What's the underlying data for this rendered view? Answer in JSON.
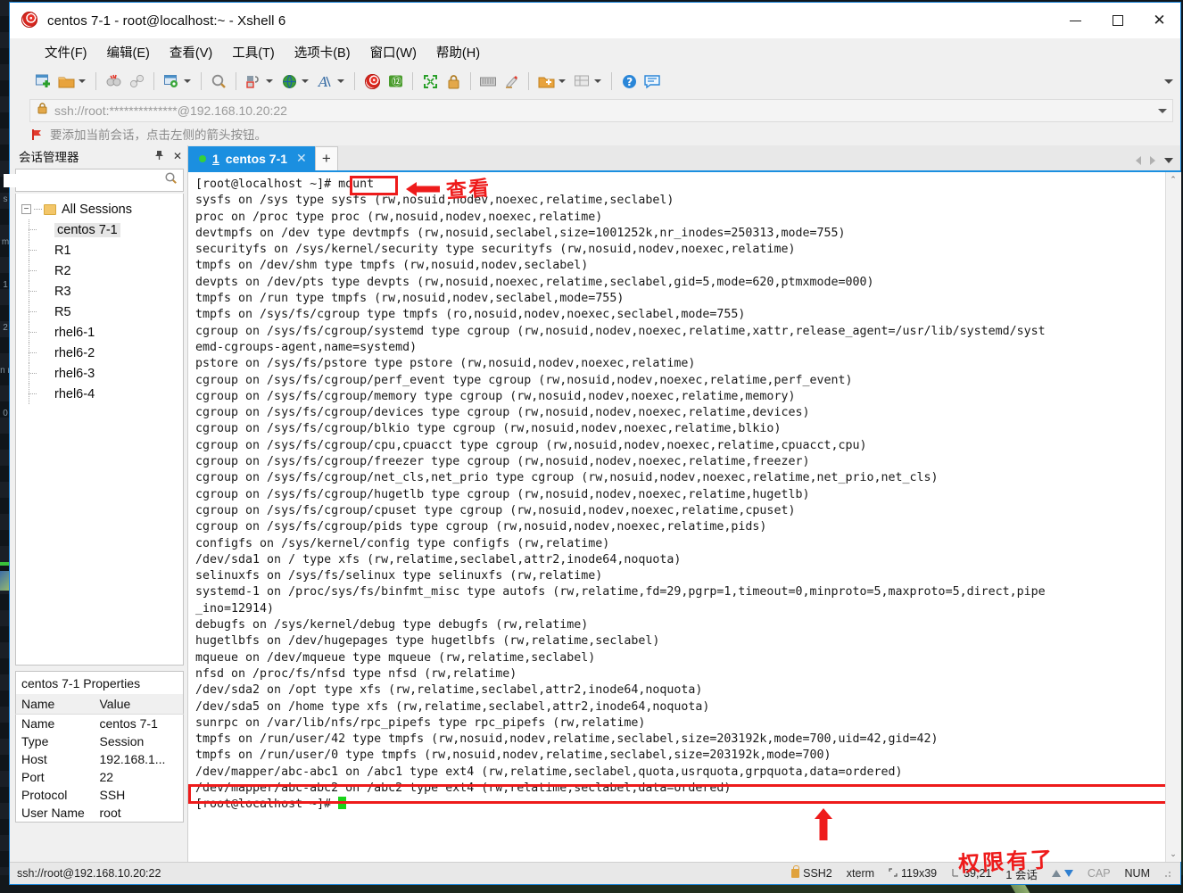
{
  "window": {
    "title": "centos 7-1 - root@localhost:~ - Xshell 6",
    "app_icon": "xshell-logo-icon",
    "controls": {
      "minimize": "–",
      "maximize": "□",
      "close": "✕"
    }
  },
  "menu": {
    "items": [
      {
        "label": "文件(F)",
        "name": "menu-file"
      },
      {
        "label": "编辑(E)",
        "name": "menu-edit"
      },
      {
        "label": "查看(V)",
        "name": "menu-view"
      },
      {
        "label": "工具(T)",
        "name": "menu-tools"
      },
      {
        "label": "选项卡(B)",
        "name": "menu-tabs"
      },
      {
        "label": "窗口(W)",
        "name": "menu-window"
      },
      {
        "label": "帮助(H)",
        "name": "menu-help"
      }
    ]
  },
  "toolbar": {
    "buttons": [
      {
        "name": "new-session-icon",
        "glyph": "▣",
        "dropdown": false
      },
      {
        "name": "open-folder-icon",
        "glyph": "📁",
        "dropdown": true
      },
      {
        "name": "disconnect-icon",
        "glyph": "✂",
        "dropdown": false
      },
      {
        "name": "reconnect-icon",
        "glyph": "🔗",
        "dropdown": false
      },
      {
        "name": "session-properties-icon",
        "glyph": "⚙",
        "dropdown": true
      },
      {
        "name": "find-icon",
        "glyph": "🔍",
        "dropdown": false
      },
      {
        "name": "transfer-file-icon",
        "glyph": "⇄",
        "dropdown": true
      },
      {
        "name": "web-browser-icon",
        "glyph": "🌐",
        "dropdown": true
      },
      {
        "name": "font-icon",
        "glyph": "A",
        "dropdown": true
      },
      {
        "name": "xshell-icon",
        "glyph": "◉",
        "dropdown": false
      },
      {
        "name": "xftp-icon",
        "glyph": "❿",
        "dropdown": false
      },
      {
        "name": "fullscreen-icon",
        "glyph": "⤢",
        "dropdown": false
      },
      {
        "name": "lock-icon",
        "glyph": "🔒",
        "dropdown": false
      },
      {
        "name": "keyboard-icon",
        "glyph": "⌨",
        "dropdown": false
      },
      {
        "name": "highlight-pen-icon",
        "glyph": "✎",
        "dropdown": false
      },
      {
        "name": "add-folder-icon",
        "glyph": "🗀",
        "dropdown": true
      },
      {
        "name": "layout-icon",
        "glyph": "▤",
        "dropdown": true
      },
      {
        "name": "help-icon",
        "glyph": "?",
        "dropdown": false
      },
      {
        "name": "chat-icon",
        "glyph": "💬",
        "dropdown": false
      }
    ],
    "overflow": "toolbar-overflow-icon"
  },
  "address_bar": {
    "lock_icon": "lock-icon",
    "url": "ssh://root:**************@192.168.10.20:22",
    "dropdown": "address-dropdown-icon"
  },
  "hint_bar": {
    "icon": "red-flag-icon",
    "text": "要添加当前会话，点击左侧的箭头按钮。"
  },
  "sidebar": {
    "header": {
      "title": "会话管理器",
      "pin": "📌",
      "close": "✕"
    },
    "search": {
      "placeholder": "",
      "value": "",
      "icon": "search-icon"
    },
    "tree": {
      "root": {
        "label": "All Sessions",
        "expander": "−"
      },
      "sessions": [
        {
          "label": "centos 7-1",
          "selected": true
        },
        {
          "label": "R1",
          "selected": false
        },
        {
          "label": "R2",
          "selected": false
        },
        {
          "label": "R3",
          "selected": false
        },
        {
          "label": "R5",
          "selected": false
        },
        {
          "label": "rhel6-1",
          "selected": false
        },
        {
          "label": "rhel6-2",
          "selected": false
        },
        {
          "label": "rhel6-3",
          "selected": false
        },
        {
          "label": "rhel6-4",
          "selected": false
        }
      ]
    },
    "properties": {
      "title": "centos 7-1 Properties",
      "columns": [
        "Name",
        "Value"
      ],
      "rows": [
        {
          "name": "Name",
          "value": "centos 7-1"
        },
        {
          "name": "Type",
          "value": "Session"
        },
        {
          "name": "Host",
          "value": "192.168.1..."
        },
        {
          "name": "Port",
          "value": "22"
        },
        {
          "name": "Protocol",
          "value": "SSH"
        },
        {
          "name": "User Name",
          "value": "root"
        }
      ],
      "footer": "ssh://root@192.168.10.20:22"
    }
  },
  "tabbar": {
    "tab": {
      "number": "1",
      "label": "centos 7-1",
      "close": "✕",
      "status_dot": "connected"
    },
    "new_tab": "+",
    "nav_prev": "◀",
    "nav_next": "▶",
    "nav_menu": "▾"
  },
  "terminal": {
    "scrollbar": {
      "up": "⌃",
      "down": "⌄"
    },
    "cursor": "block-cursor",
    "lines": [
      "[root@localhost ~]# mount",
      "sysfs on /sys type sysfs (rw,nosuid,nodev,noexec,relatime,seclabel)",
      "proc on /proc type proc (rw,nosuid,nodev,noexec,relatime)",
      "devtmpfs on /dev type devtmpfs (rw,nosuid,seclabel,size=1001252k,nr_inodes=250313,mode=755)",
      "securityfs on /sys/kernel/security type securityfs (rw,nosuid,nodev,noexec,relatime)",
      "tmpfs on /dev/shm type tmpfs (rw,nosuid,nodev,seclabel)",
      "devpts on /dev/pts type devpts (rw,nosuid,noexec,relatime,seclabel,gid=5,mode=620,ptmxmode=000)",
      "tmpfs on /run type tmpfs (rw,nosuid,nodev,seclabel,mode=755)",
      "tmpfs on /sys/fs/cgroup type tmpfs (ro,nosuid,nodev,noexec,seclabel,mode=755)",
      "cgroup on /sys/fs/cgroup/systemd type cgroup (rw,nosuid,nodev,noexec,relatime,xattr,release_agent=/usr/lib/systemd/syst",
      "emd-cgroups-agent,name=systemd)",
      "pstore on /sys/fs/pstore type pstore (rw,nosuid,nodev,noexec,relatime)",
      "cgroup on /sys/fs/cgroup/perf_event type cgroup (rw,nosuid,nodev,noexec,relatime,perf_event)",
      "cgroup on /sys/fs/cgroup/memory type cgroup (rw,nosuid,nodev,noexec,relatime,memory)",
      "cgroup on /sys/fs/cgroup/devices type cgroup (rw,nosuid,nodev,noexec,relatime,devices)",
      "cgroup on /sys/fs/cgroup/blkio type cgroup (rw,nosuid,nodev,noexec,relatime,blkio)",
      "cgroup on /sys/fs/cgroup/cpu,cpuacct type cgroup (rw,nosuid,nodev,noexec,relatime,cpuacct,cpu)",
      "cgroup on /sys/fs/cgroup/freezer type cgroup (rw,nosuid,nodev,noexec,relatime,freezer)",
      "cgroup on /sys/fs/cgroup/net_cls,net_prio type cgroup (rw,nosuid,nodev,noexec,relatime,net_prio,net_cls)",
      "cgroup on /sys/fs/cgroup/hugetlb type cgroup (rw,nosuid,nodev,noexec,relatime,hugetlb)",
      "cgroup on /sys/fs/cgroup/cpuset type cgroup (rw,nosuid,nodev,noexec,relatime,cpuset)",
      "cgroup on /sys/fs/cgroup/pids type cgroup (rw,nosuid,nodev,noexec,relatime,pids)",
      "configfs on /sys/kernel/config type configfs (rw,relatime)",
      "/dev/sda1 on / type xfs (rw,relatime,seclabel,attr2,inode64,noquota)",
      "selinuxfs on /sys/fs/selinux type selinuxfs (rw,relatime)",
      "systemd-1 on /proc/sys/fs/binfmt_misc type autofs (rw,relatime,fd=29,pgrp=1,timeout=0,minproto=5,maxproto=5,direct,pipe",
      "_ino=12914)",
      "debugfs on /sys/kernel/debug type debugfs (rw,relatime)",
      "hugetlbfs on /dev/hugepages type hugetlbfs (rw,relatime,seclabel)",
      "mqueue on /dev/mqueue type mqueue (rw,relatime,seclabel)",
      "nfsd on /proc/fs/nfsd type nfsd (rw,relatime)",
      "/dev/sda2 on /opt type xfs (rw,relatime,seclabel,attr2,inode64,noquota)",
      "/dev/sda5 on /home type xfs (rw,relatime,seclabel,attr2,inode64,noquota)",
      "sunrpc on /var/lib/nfs/rpc_pipefs type rpc_pipefs (rw,relatime)",
      "tmpfs on /run/user/42 type tmpfs (rw,nosuid,nodev,relatime,seclabel,size=203192k,mode=700,uid=42,gid=42)",
      "tmpfs on /run/user/0 type tmpfs (rw,nosuid,nodev,relatime,seclabel,size=203192k,mode=700)",
      "/dev/mapper/abc-abc1 on /abc1 type ext4 (rw,relatime,seclabel,quota,usrquota,grpquota,data=ordered)",
      "/dev/mapper/abc-abc2 on /abc2 type ext4 (rw,relatime,seclabel,data=ordered)",
      "[root@localhost ~]# "
    ]
  },
  "annotations": {
    "highlight_color": "#ee1b1b",
    "mount_box_label": "mount",
    "arrow_left_note": "查看",
    "arrow_up_note": "权限有了"
  },
  "statusbar": {
    "left": "ssh://root@192.168.10.20:22",
    "protocol": "SSH2",
    "terminal_type": "xterm",
    "size": "119x39",
    "cursor_pos": "39,21",
    "sessions": "1 会话",
    "cap": "CAP",
    "num": "NUM"
  }
}
